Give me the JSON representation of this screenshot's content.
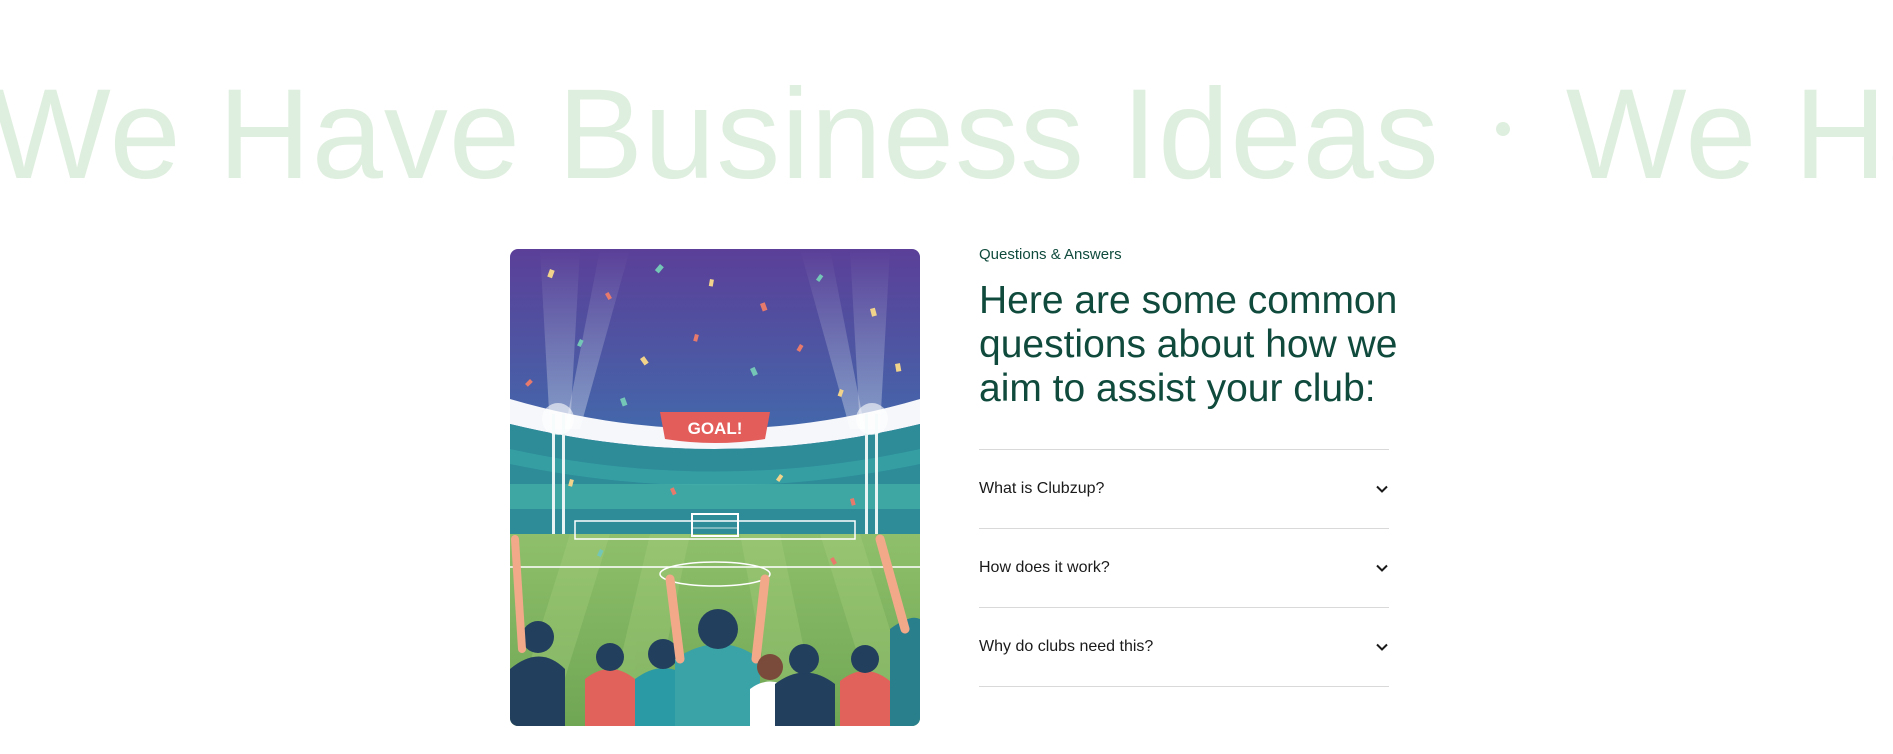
{
  "marquee": {
    "text_1": "We Have Business Ideas",
    "text_2": "We Hav"
  },
  "hero_image": {
    "banner_text": "GOAL!"
  },
  "faq": {
    "eyebrow": "Questions & Answers",
    "headline": "Here are some common questions about how we aim to assist your club:",
    "items": [
      {
        "question": "What is Clubzup?",
        "icon": "chevron-down-icon"
      },
      {
        "question": "How does it work?",
        "icon": "chevron-down-icon"
      },
      {
        "question": "Why do clubs need this?",
        "icon": "chevron-down-icon"
      }
    ]
  },
  "colors": {
    "brand_dark_green": "#0f4a3c",
    "marquee_tint": "#dfefdf",
    "divider": "#d9d9d9"
  }
}
